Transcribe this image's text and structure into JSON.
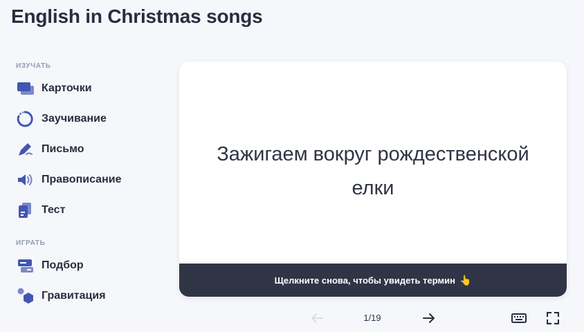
{
  "title": "English in Christmas songs",
  "sidebar": {
    "study_label": "ИЗУЧАТЬ",
    "play_label": "ИГРАТЬ",
    "study_items": [
      {
        "label": "Карточки",
        "icon": "flashcards-icon"
      },
      {
        "label": "Заучивание",
        "icon": "learn-icon"
      },
      {
        "label": "Письмо",
        "icon": "write-icon"
      },
      {
        "label": "Правописание",
        "icon": "spell-icon"
      },
      {
        "label": "Тест",
        "icon": "test-icon"
      }
    ],
    "play_items": [
      {
        "label": "Подбор",
        "icon": "match-icon"
      },
      {
        "label": "Гравитация",
        "icon": "gravity-icon"
      }
    ]
  },
  "card": {
    "text": "Зажигаем вокруг рождественской елки",
    "footer_hint": "Щелкните снова, чтобы увидеть термин",
    "footer_emoji": "👆"
  },
  "controls": {
    "counter": "1/19"
  },
  "colors": {
    "accent": "#4257b2",
    "accent_light": "#7b89c9",
    "footer_bg": "#303545",
    "background": "#f6f7fb"
  }
}
